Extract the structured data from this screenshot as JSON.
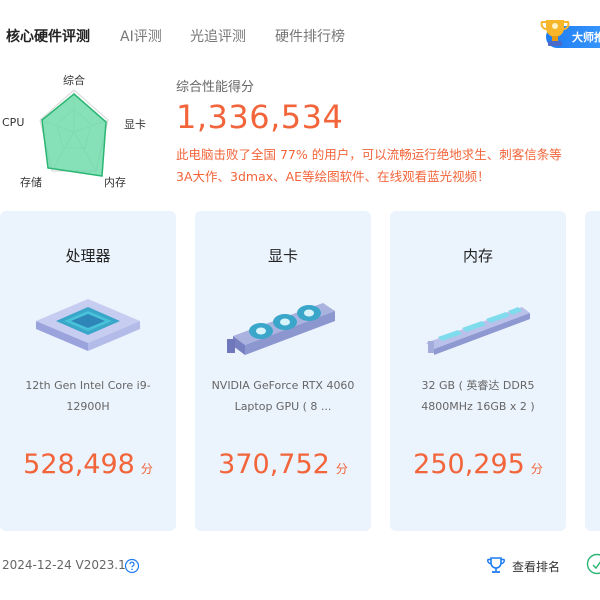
{
  "tabs": [
    {
      "label": "核心硬件评测",
      "active": true
    },
    {
      "label": "AI评测",
      "active": false
    },
    {
      "label": "光追评测",
      "active": false
    },
    {
      "label": "硬件排行榜",
      "active": false
    }
  ],
  "badge": {
    "label": "大师推"
  },
  "radar": {
    "labels": {
      "top": "综合",
      "right": "显卡",
      "bottom_right": "内存",
      "bottom_left": "存储",
      "left": "CPU"
    },
    "colors": {
      "fill": "#5fd7a0",
      "stroke": "#2bb673",
      "grid": "#d6d6d6"
    }
  },
  "summary": {
    "title": "综合性能得分",
    "score": "1,336,534",
    "desc_line1": "此电脑击败了全国 77% 的用户，可以流畅运行绝地求生、刺客信条等",
    "desc_line2": "3A大作、3dmax、AE等绘图软件、在线观看蓝光视频！"
  },
  "cards": [
    {
      "title": "处理器",
      "name": "12th Gen Intel Core i9-12900H",
      "score": "528,498",
      "unit": "分"
    },
    {
      "title": "显卡",
      "name": "NVIDIA GeForce RTX 4060 Laptop GPU ( 8 ...",
      "score": "370,752",
      "unit": "分"
    },
    {
      "title": "内存",
      "name": "32 GB ( 英睿达 DDR5 4800MHz 16GB x 2 )",
      "score": "250,295",
      "unit": "分"
    }
  ],
  "footer": {
    "date_version": "2024-12-24 V2023.1",
    "rank_label": "查看排名"
  },
  "colors": {
    "accent": "#f2643a",
    "card_bg": "#ebf3fd",
    "primary_blue": "#1d7cf2"
  }
}
